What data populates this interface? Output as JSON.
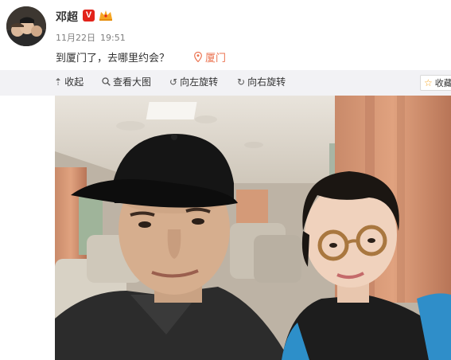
{
  "user": {
    "name": "邓超",
    "verified_badge": "V",
    "avatar_icon": "user-avatar",
    "vip_icon": "crown-icon"
  },
  "post": {
    "date": "11月22日",
    "time": "19:51",
    "text": "到厦门了，去哪里约会？",
    "location": "厦门",
    "location_icon": "location-pin-icon"
  },
  "toolbar": {
    "collapse": "收起",
    "view_large": "查看大图",
    "rotate_left": "向左旋转",
    "rotate_right": "向右旋转",
    "favorite": "收藏"
  },
  "colors": {
    "verified": "#e2231a",
    "location": "#eb7350",
    "toolbar_bg": "#f2f2f5"
  }
}
